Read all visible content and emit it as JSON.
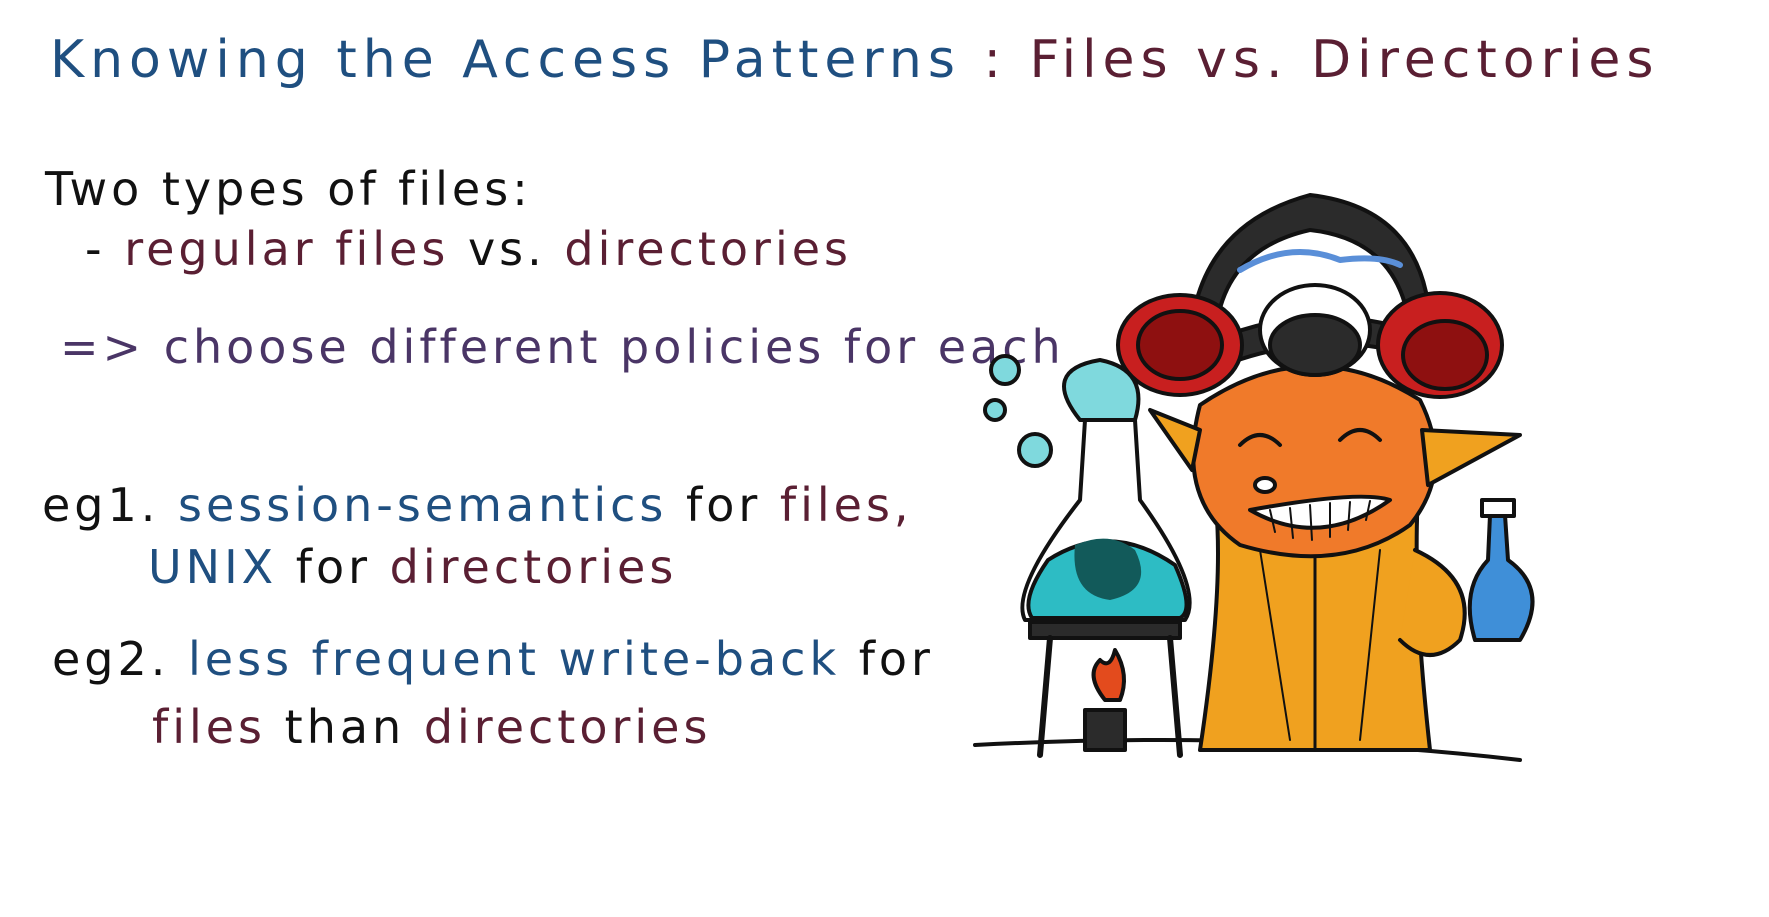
{
  "title": {
    "part1": "Knowing the Access Patterns",
    "colon": ":",
    "part2": "Files vs. Directories"
  },
  "lines": {
    "l1": "Two types of files:",
    "l2_dash": "-",
    "l2_a": "regular files",
    "l2_b": "vs.",
    "l2_c": "directories",
    "l3_arrow": "=>",
    "l3": "choose different policies for each",
    "eg1_label": "eg1.",
    "eg1_a": "session-semantics",
    "eg1_b": "for",
    "eg1_c": "files,",
    "eg1_d": "UNIX",
    "eg1_e": "for",
    "eg1_f": "directories",
    "eg2_label": "eg2.",
    "eg2_a": "less frequent write-back",
    "eg2_b": "for",
    "eg2_c": "files",
    "eg2_d": "than",
    "eg2_e": "directories"
  },
  "colors": {
    "blue": "#1f4f80",
    "maroon": "#5a1f33",
    "black": "#111111",
    "purple": "#4a3566"
  }
}
